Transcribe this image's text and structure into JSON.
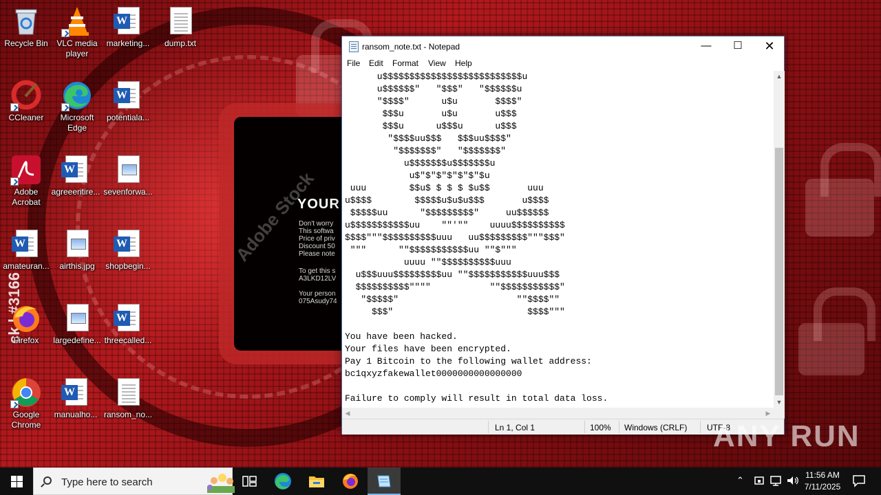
{
  "desktop": {
    "icons": [
      {
        "label": "Recycle Bin",
        "icon": "recycle-bin-icon"
      },
      {
        "label": "VLC media player",
        "icon": "vlc-icon"
      },
      {
        "label": "marketing...",
        "icon": "word-doc-icon"
      },
      {
        "label": "dump.txt",
        "icon": "text-file-icon"
      },
      {
        "label": "CCleaner",
        "icon": "ccleaner-icon"
      },
      {
        "label": "Microsoft Edge",
        "icon": "edge-icon"
      },
      {
        "label": "potentiala...",
        "icon": "word-doc-icon"
      },
      {
        "label": "Adobe Acrobat",
        "icon": "acrobat-icon"
      },
      {
        "label": "agreeentire...",
        "icon": "word-doc-icon"
      },
      {
        "label": "sevenforwa...",
        "icon": "image-file-icon"
      },
      {
        "label": "amateuran...",
        "icon": "word-doc-icon"
      },
      {
        "label": "airthis.jpg",
        "icon": "image-file-icon"
      },
      {
        "label": "shopbegin...",
        "icon": "word-doc-icon"
      },
      {
        "label": "Firefox",
        "icon": "firefox-icon"
      },
      {
        "label": "largedefine...",
        "icon": "image-file-icon"
      },
      {
        "label": "threecalled...",
        "icon": "word-doc-icon"
      },
      {
        "label": "Google Chrome",
        "icon": "chrome-icon"
      },
      {
        "label": "manualho...",
        "icon": "word-doc-icon"
      },
      {
        "label": "ransom_no...",
        "icon": "text-file-icon"
      }
    ],
    "wallpaper": {
      "headline": "YOUR",
      "lines": [
        "Don't worry",
        "This softwa",
        "Price of priv",
        "Discount 50",
        "Please note",
        "To get this s",
        "A3LKD12LV",
        "Your person",
        "075Asudy74"
      ],
      "watermark": "Adobe Stock",
      "side_text": "ck | #3166"
    }
  },
  "notepad": {
    "title": "ransom_note.txt - Notepad",
    "menu": [
      "File",
      "Edit",
      "Format",
      "View",
      "Help"
    ],
    "content_lines": [
      "      u$$$$$$$$$$$$$$$$$$$$$$$$$$u",
      "      u$$$$$$\"   \"$$$\"   \"$$$$$$u",
      "      \"$$$$\"      u$u       $$$$\"",
      "       $$$u       u$u       u$$$",
      "       $$$u      u$$$u      u$$$",
      "        \"$$$$uu$$$   $$$uu$$$$\"",
      "         \"$$$$$$$\"   \"$$$$$$$\"",
      "           u$$$$$$$u$$$$$$$u",
      "            u$\"$\"$\"$\"$\"$\"$u",
      " uuu        $$u$ $ $ $ $u$$       uuu",
      "u$$$$        $$$$$u$u$u$$$       u$$$$",
      " $$$$$uu      \"$$$$$$$$$\"     uu$$$$$$",
      "u$$$$$$$$$$$uu    \"\"'\"\"    uuuu$$$$$$$$$$",
      "$$$$\"\"\"$$$$$$$$$$uuu   uu$$$$$$$$$\"\"\"$$$\"",
      " \"\"\"      \"\"$$$$$$$$$$$uu \"\"$\"\"\"",
      "           uuuu \"\"$$$$$$$$$$uuu",
      "  u$$$uuu$$$$$$$$$uu \"\"$$$$$$$$$$$uuu$$$",
      "  $$$$$$$$$$\"\"\"\"           \"\"$$$$$$$$$$$\"",
      "   \"$$$$$\"                      \"\"$$$$\"\"",
      "     $$$\"                         $$$$\"\"\"",
      "",
      "You have been hacked.",
      "Your files have been encrypted.",
      "Pay 1 Bitcoin to the following wallet address:",
      "bc1qxyzfakewallet0000000000000000",
      "",
      "Failure to comply will result in total data loss."
    ],
    "status": {
      "position": "Ln 1, Col 1",
      "zoom": "100%",
      "line_ending": "Windows (CRLF)",
      "encoding": "UTF-8"
    }
  },
  "watermark": "ANY RUN",
  "taskbar": {
    "search_placeholder": "Type here to search",
    "pinned": [
      "task-view-icon",
      "edge-icon",
      "file-explorer-icon",
      "firefox-icon",
      "notepad-icon"
    ],
    "clock_time": "11:56 AM",
    "clock_date": "7/11/2025"
  },
  "colors": {
    "taskbar": "#101010",
    "accent": "#77b7ea",
    "word_blue": "#1f5bb3"
  }
}
